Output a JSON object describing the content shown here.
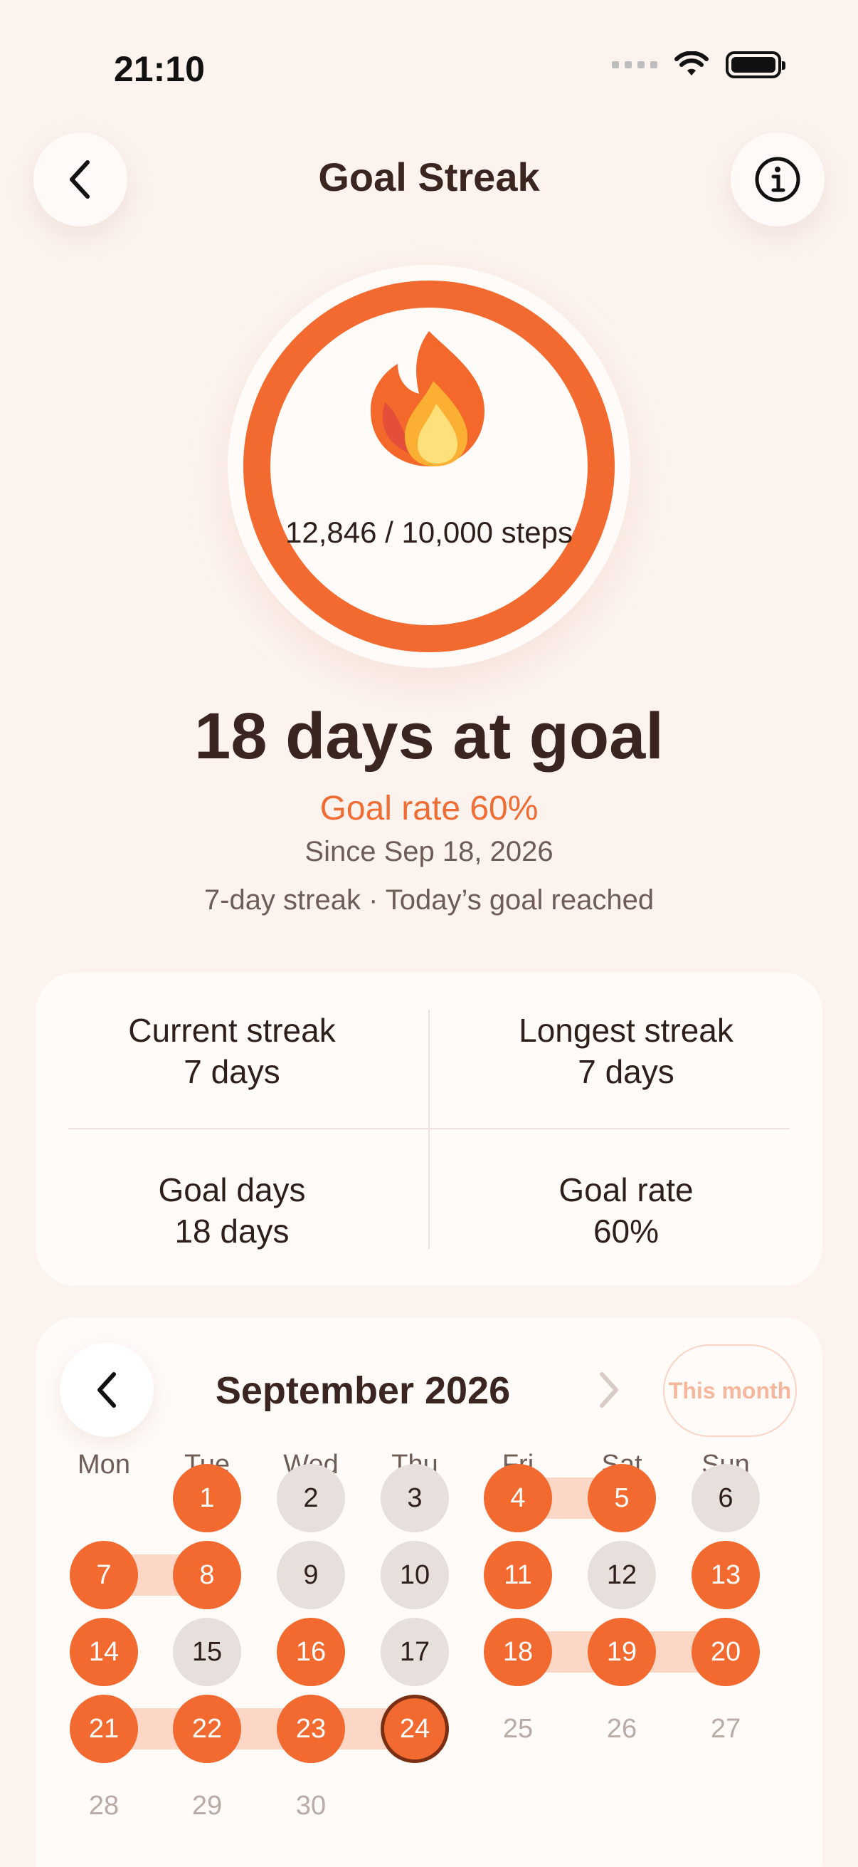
{
  "status": {
    "time": "21:10"
  },
  "header": {
    "title": "Goal Streak"
  },
  "ring": {
    "steps_text": "12,846 / 10,000 steps",
    "progress": 1.0,
    "color": "#f26a2f",
    "icon": "flame-icon"
  },
  "summary": {
    "headline": "18 days at goal",
    "rate": "Goal rate 60%",
    "since": "Since Sep 18, 2026",
    "streak_note": "7-day streak · Today’s goal reached"
  },
  "stats": {
    "current_label": "Current streak",
    "current_value": "7 days",
    "longest_label": "Longest streak",
    "longest_value": "7 days",
    "goal_days_label": "Goal days",
    "goal_days_value": "18 days",
    "goal_rate_label": "Goal rate",
    "goal_rate_value": "60%"
  },
  "calendar": {
    "month": "September 2026",
    "this_month_label": "This month",
    "weekdays": [
      "Mon",
      "Tue",
      "Wed",
      "Thu",
      "Fri",
      "Sat",
      "Sun"
    ],
    "first_weekday_index": 1,
    "days": [
      {
        "d": "1",
        "s": "hit"
      },
      {
        "d": "2",
        "s": "miss"
      },
      {
        "d": "3",
        "s": "miss"
      },
      {
        "d": "4",
        "s": "hit"
      },
      {
        "d": "5",
        "s": "hit"
      },
      {
        "d": "6",
        "s": "miss"
      },
      {
        "d": "7",
        "s": "hit"
      },
      {
        "d": "8",
        "s": "hit"
      },
      {
        "d": "9",
        "s": "miss"
      },
      {
        "d": "10",
        "s": "miss"
      },
      {
        "d": "11",
        "s": "hit"
      },
      {
        "d": "12",
        "s": "miss"
      },
      {
        "d": "13",
        "s": "hit"
      },
      {
        "d": "14",
        "s": "hit"
      },
      {
        "d": "15",
        "s": "miss"
      },
      {
        "d": "16",
        "s": "hit"
      },
      {
        "d": "17",
        "s": "miss"
      },
      {
        "d": "18",
        "s": "hit"
      },
      {
        "d": "19",
        "s": "hit"
      },
      {
        "d": "20",
        "s": "hit"
      },
      {
        "d": "21",
        "s": "hit"
      },
      {
        "d": "22",
        "s": "hit"
      },
      {
        "d": "23",
        "s": "hit"
      },
      {
        "d": "24",
        "s": "today"
      },
      {
        "d": "25",
        "s": "future"
      },
      {
        "d": "26",
        "s": "future"
      },
      {
        "d": "27",
        "s": "future"
      },
      {
        "d": "28",
        "s": "future"
      },
      {
        "d": "29",
        "s": "future"
      },
      {
        "d": "30",
        "s": "future"
      }
    ]
  }
}
